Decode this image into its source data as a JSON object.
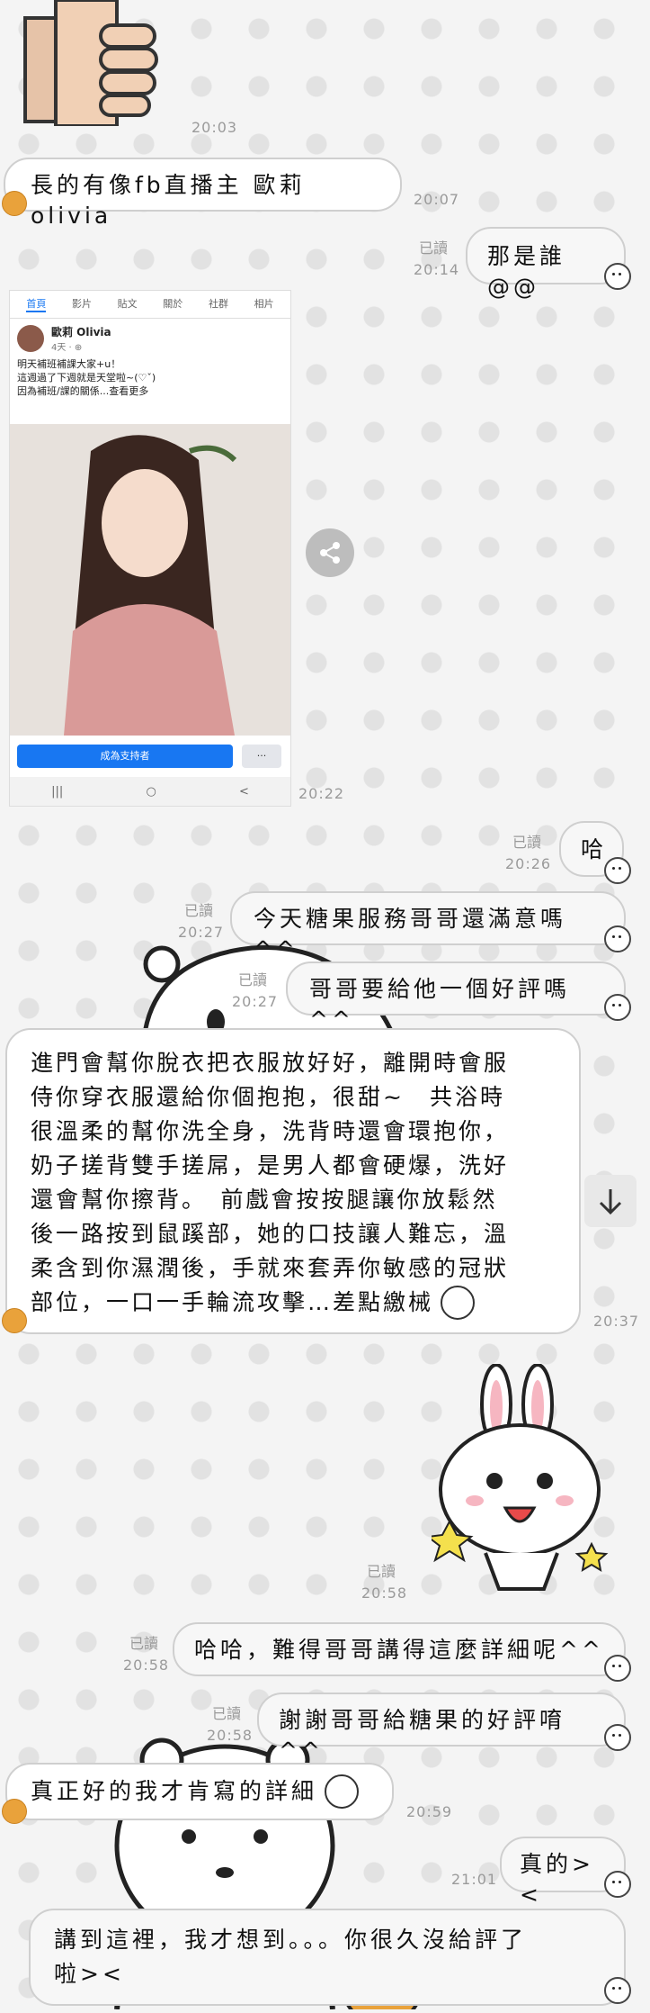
{
  "messages": [
    {
      "time": "20:03"
    },
    {
      "text": "長的有像fb直播主 歐莉olivia",
      "time": "20:07"
    },
    {
      "text": "那是誰@@",
      "read": "已讀",
      "time": "20:14"
    },
    {
      "time": "20:22"
    },
    {
      "text": "哈",
      "read": "已讀",
      "time": "20:26"
    },
    {
      "text": "今天糖果服務哥哥還滿意嗎^^",
      "read": "已讀",
      "time": "20:27"
    },
    {
      "text": "哥哥要給他一個好評嗎^^",
      "read": "已讀",
      "time": "20:27"
    },
    {
      "lines": [
        "進門會幫你脫衣把衣服放好好，離開時會服",
        "侍你穿衣服還給你個抱抱，很甜~　共浴時",
        "很溫柔的幫你洗全身，洗背時還會環抱你，",
        "奶子搓背雙手搓屌，是男人都會硬爆，洗好",
        "還會幫你擦背。　前戲會按按腿讓你放鬆然",
        "後一路按到鼠蹊部，她的口技讓人難忘，溫",
        "柔含到你濕潤後，手就來套弄你敏感的冠狀",
        "部位，一口一手輪流攻擊…差點繳械"
      ],
      "time": "20:37"
    },
    {
      "read": "已讀",
      "time": "20:58"
    },
    {
      "text": "哈哈，難得哥哥講得這麼詳細呢^^",
      "read": "已讀",
      "time": "20:58"
    },
    {
      "text": "謝謝哥哥給糖果的好評唷^^",
      "read": "已讀",
      "time": "20:58"
    },
    {
      "text": "真正好的我才肯寫的詳細",
      "time": "20:59"
    },
    {
      "text": "真的><",
      "time": "21:01"
    },
    {
      "lines": [
        "講到這裡，我才想到。。。你很久沒給評了",
        "啦><"
      ]
    }
  ],
  "fb_post": {
    "tabs": [
      "首頁",
      "影片",
      "貼文",
      "關於",
      "社群",
      "相片"
    ],
    "name": "歐莉 Olivia",
    "meta": "4天 · ⊕",
    "lines": [
      "明天補班補課大家+u！",
      "這週過了下週就是天堂啦~(♡ˇ)",
      "因為補班/課的關係...查看更多"
    ],
    "support": "成為支持者",
    "more": "···",
    "nav": [
      "|||",
      "○",
      "<"
    ]
  },
  "icons": [
    "share-icon",
    "scroll-down-icon",
    "thumbs-up-sticker",
    "rabbit-sticker",
    "bear-sticker"
  ],
  "colors": {
    "bubble_border": "#cfcfcf",
    "time": "#9a9a9a",
    "fb_blue": "#1877f2",
    "avatar": "#e9a23b"
  }
}
